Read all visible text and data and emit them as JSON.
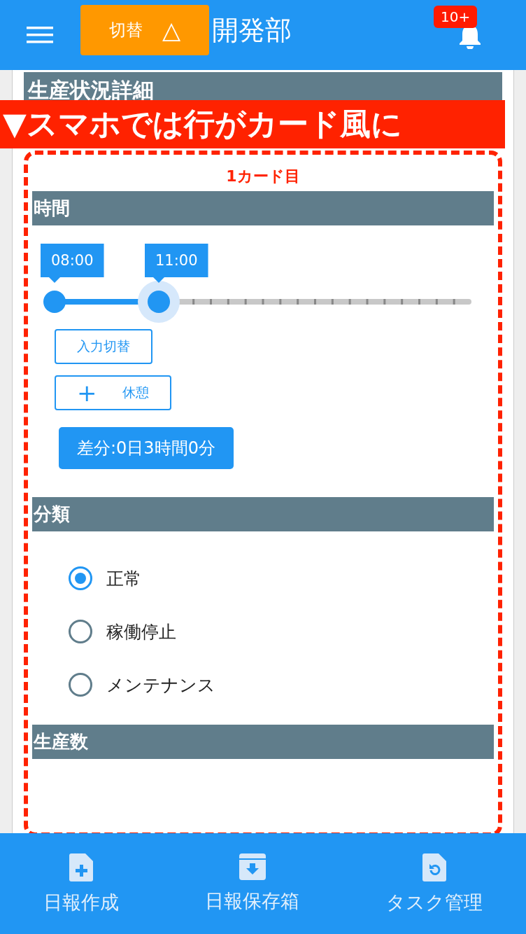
{
  "app_bar": {
    "switch_button": {
      "label": "切替",
      "icon": "△"
    },
    "title": "開発部",
    "notification_badge": "10+"
  },
  "panel_header": {
    "title": "生産状況詳細"
  },
  "banner": "▼スマホでは行がカード風に",
  "card": {
    "caption": "1カード目",
    "sections": [
      {
        "kind": "time",
        "title": "時間",
        "thumbs": [
          {
            "label": "08:00",
            "level": 0,
            "focused": false
          },
          {
            "label": "11:00",
            "level": 0.25,
            "focused": true
          }
        ],
        "buttons": [
          {
            "label": "入力切替"
          },
          {
            "label": "休憩",
            "icon": "+"
          }
        ],
        "difference": "差分:0日3時間0分"
      },
      {
        "kind": "radio",
        "title": "分類",
        "options": [
          {
            "label": "正常",
            "selected": true
          },
          {
            "label": "稼働停止",
            "selected": false
          },
          {
            "label": "メンテナンス",
            "selected": false
          }
        ]
      },
      {
        "kind": "empty",
        "title": "生産数"
      }
    ]
  },
  "bottom_nav": [
    {
      "label": "日報作成"
    },
    {
      "label": "日報保存箱"
    },
    {
      "label": "タスク管理"
    }
  ]
}
